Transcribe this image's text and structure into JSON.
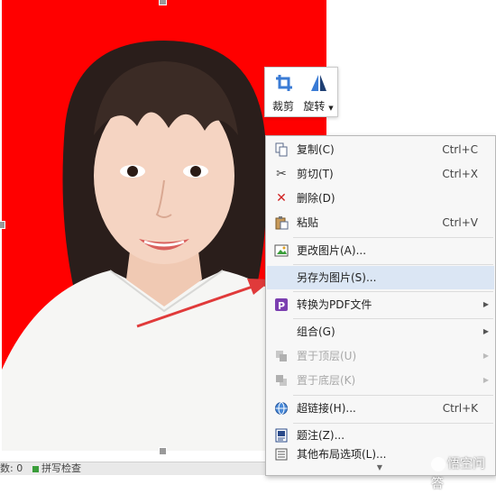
{
  "toolbar": {
    "crop_label": "裁剪",
    "rotate_label": "旋转"
  },
  "context_menu": {
    "copy": {
      "label": "复制(C)",
      "shortcut": "Ctrl+C"
    },
    "cut": {
      "label": "剪切(T)",
      "shortcut": "Ctrl+X"
    },
    "delete": {
      "label": "删除(D)"
    },
    "paste": {
      "label": "粘贴",
      "shortcut": "Ctrl+V"
    },
    "change_picture": {
      "label": "更改图片(A)..."
    },
    "save_as_picture": {
      "label": "另存为图片(S)..."
    },
    "convert_pdf": {
      "label": "转换为PDF文件"
    },
    "group": {
      "label": "组合(G)"
    },
    "bring_to_front": {
      "label": "置于顶层(U)"
    },
    "send_to_back": {
      "label": "置于底层(K)"
    },
    "hyperlink": {
      "label": "超链接(H)...",
      "shortcut": "Ctrl+K"
    },
    "caption": {
      "label": "题注(Z)..."
    },
    "other_layout": {
      "label": "其他布局选项(L)..."
    }
  },
  "statusbar": {
    "word_count": "数: 0",
    "spell_check": "拼写检查"
  },
  "watermark": "悟空问答",
  "colors": {
    "photo_background": "#ff0000",
    "menu_highlight": "#dbe6f4",
    "annotation_arrow": "#e03a3a"
  },
  "icons": {
    "crop": "crop-icon",
    "rotate": "rotate-icon",
    "copy": "copy-icon",
    "cut": "scissors-icon",
    "delete": "red-x-icon",
    "paste": "clipboard-icon",
    "change_picture": "picture-icon",
    "convert_pdf": "pdf-icon",
    "hyperlink": "globe-link-icon",
    "caption": "caption-icon",
    "other_layout": "layout-icon"
  }
}
